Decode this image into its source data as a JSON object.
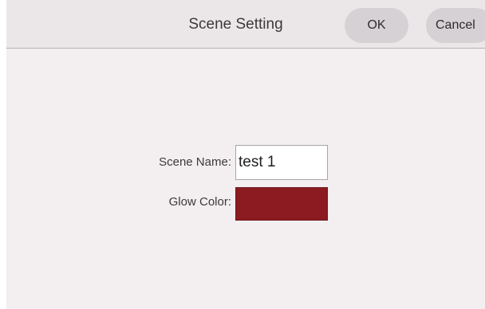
{
  "header": {
    "title": "Scene Setting",
    "ok_label": "OK",
    "cancel_label": "Cancel"
  },
  "form": {
    "scene_name_label": "Scene Name:",
    "scene_name_value": "test 1",
    "glow_color_label": "Glow Color:",
    "glow_color_value": "#8b1b20"
  }
}
